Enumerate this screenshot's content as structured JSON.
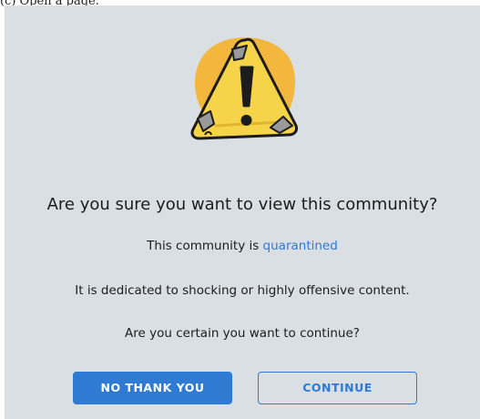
{
  "caption": "(c) Open a page.",
  "dialog": {
    "illustration_icon": "warning-triangle-icon",
    "heading": "Are you sure you want to view this community?",
    "line1_prefix": "This community is ",
    "line1_link": "quarantined",
    "line2": "It is dedicated to shocking or highly offensive content.",
    "line3": "Are you certain you want to continue?",
    "decline_label": "NO THANK YOU",
    "continue_label": "CONTINUE"
  },
  "colors": {
    "panel_bg": "#dadfe4",
    "accent": "#2f7ad3",
    "warning_yellow": "#f6d44a",
    "warning_orange": "#f4b73d"
  }
}
